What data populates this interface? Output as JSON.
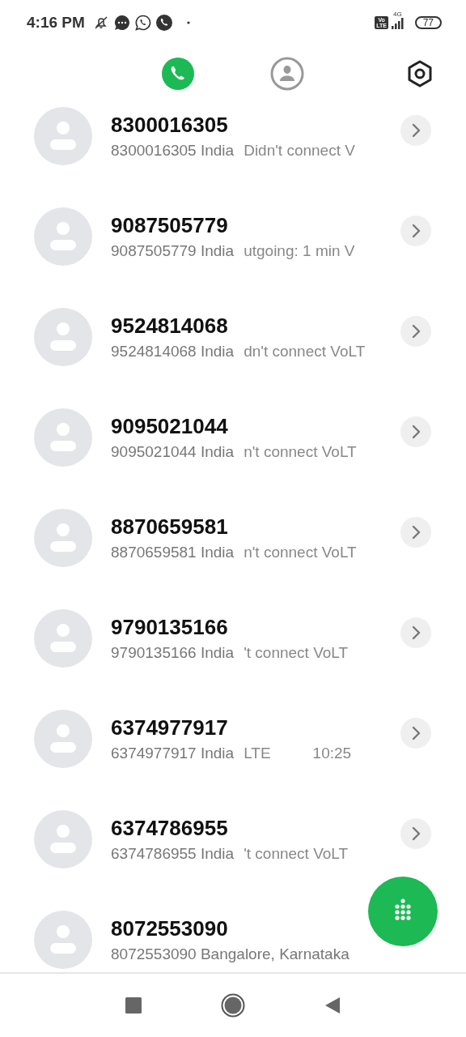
{
  "status_bar": {
    "time": "4:16 PM",
    "volte_top": "Vo",
    "volte_bottom": "LTE",
    "network": "4G",
    "battery": "77"
  },
  "tabs": [
    {
      "kind": "calls",
      "selected": true
    },
    {
      "kind": "contacts",
      "selected": false
    }
  ],
  "calls": [
    {
      "name": "8300016305",
      "location": "8300016305 India",
      "detail": "Didn't connect V"
    },
    {
      "name": "9087505779",
      "location": "9087505779 India",
      "detail": "utgoing: 1 min V"
    },
    {
      "name": "9524814068",
      "location": "9524814068 India",
      "detail": "dn't connect VoLT"
    },
    {
      "name": "9095021044",
      "location": "9095021044 India",
      "detail": "n't connect VoLT"
    },
    {
      "name": "8870659581",
      "location": "8870659581 India",
      "detail": "n't connect VoLT"
    },
    {
      "name": "9790135166",
      "location": "9790135166 India",
      "detail": "'t connect VoLT"
    },
    {
      "name": "6374977917",
      "location": "6374977917 India",
      "detail": "LTE",
      "time": "10:25"
    },
    {
      "name": "6374786955",
      "location": "6374786955 India",
      "detail": "'t connect VoLT"
    },
    {
      "name": "8072553090",
      "location": "8072553090 Bangalore, Karnataka"
    }
  ]
}
